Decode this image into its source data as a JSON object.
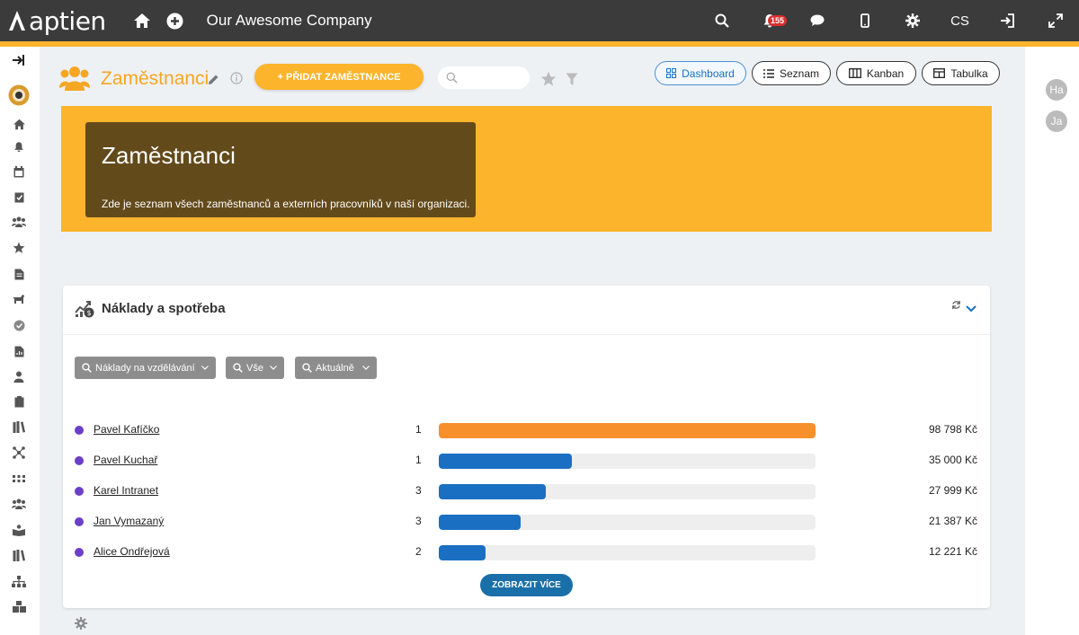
{
  "app": {
    "logo_text": "aptien",
    "company": "Our Awesome Company"
  },
  "topbar": {
    "notification_count": "155",
    "language": "CS"
  },
  "header": {
    "title": "Zaměstnanci",
    "add_button": "+ PŘIDAT ZAMĚSTNANCE",
    "search_placeholder": "",
    "views": [
      {
        "label": "Dashboard",
        "active": true
      },
      {
        "label": "Seznam",
        "active": false
      },
      {
        "label": "Kanban",
        "active": false
      },
      {
        "label": "Tabulka",
        "active": false
      }
    ]
  },
  "banner": {
    "title": "Zaměstnanci",
    "description": "Zde je seznam všech zaměstnanců a externích pracovníků v naší organizaci."
  },
  "right_panel": {
    "avatars": [
      "Ha",
      "Ja"
    ]
  },
  "widget": {
    "title": "Náklady a spotřeba",
    "filters": [
      "Náklady na vzdělávání",
      "Vše",
      "Aktuálně"
    ],
    "more_button": "ZOBRAZIT VÍCE",
    "rows": [
      {
        "name": "Pavel Kafíčko",
        "count": "1",
        "amount": "98 798 Kč",
        "fraction": 1.0,
        "color": "#f78f2a"
      },
      {
        "name": "Pavel Kuchař",
        "count": "1",
        "amount": "35 000 Kč",
        "fraction": 0.354,
        "color": "#1a6fc2"
      },
      {
        "name": "Karel Intranet",
        "count": "3",
        "amount": "27 999 Kč",
        "fraction": 0.283,
        "color": "#1a6fc2"
      },
      {
        "name": "Jan Vymazaný",
        "count": "3",
        "amount": "21 387 Kč",
        "fraction": 0.216,
        "color": "#1a6fc2"
      },
      {
        "name": "Alice Ondřejová",
        "count": "2",
        "amount": "12 221 Kč",
        "fraction": 0.124,
        "color": "#1a6fc2"
      }
    ]
  },
  "colors": {
    "accent": "#fbb42b",
    "topbar": "#3b3b3b",
    "banner_box": "#634a1b",
    "link_blue": "#1a6fc2"
  }
}
